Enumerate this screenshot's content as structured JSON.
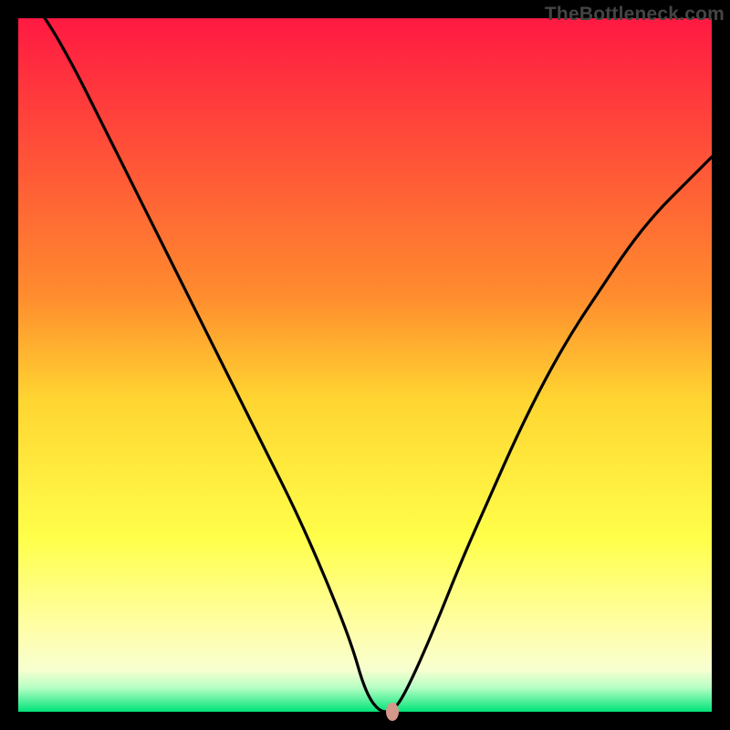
{
  "watermark": "TheBottleneck.com",
  "chart_data": {
    "type": "line",
    "title": "",
    "xlabel": "",
    "ylabel": "",
    "xlim": [
      0,
      100
    ],
    "ylim": [
      0,
      100
    ],
    "grid": false,
    "series": [
      {
        "name": "curve",
        "x": [
          0,
          4,
          8,
          12,
          16,
          20,
          24,
          28,
          32,
          36,
          40,
          44,
          48,
          50,
          52,
          54,
          56,
          60,
          64,
          68,
          72,
          76,
          80,
          84,
          88,
          92,
          96,
          100
        ],
        "values": [
          105,
          100,
          93,
          85,
          77,
          69,
          61,
          53,
          45,
          37,
          29,
          20,
          10,
          3,
          0,
          0,
          3,
          12,
          22,
          31,
          40,
          48,
          55,
          61,
          67,
          72,
          76,
          80
        ]
      }
    ],
    "flat_bottom": {
      "x_start": 50,
      "x_end": 54,
      "y": 0
    },
    "marker": {
      "x": 54,
      "y": 0,
      "color": "#d4988a"
    },
    "gradient": {
      "type": "vertical",
      "stops": [
        {
          "pos": 0.0,
          "color": "#ff1942"
        },
        {
          "pos": 0.4,
          "color": "#ff8c2e"
        },
        {
          "pos": 0.55,
          "color": "#ffd531"
        },
        {
          "pos": 0.75,
          "color": "#ffff4a"
        },
        {
          "pos": 0.88,
          "color": "#fffea8"
        },
        {
          "pos": 0.94,
          "color": "#f7ffd0"
        },
        {
          "pos": 0.965,
          "color": "#b7ffc4"
        },
        {
          "pos": 1.0,
          "color": "#00e47a"
        }
      ]
    }
  }
}
